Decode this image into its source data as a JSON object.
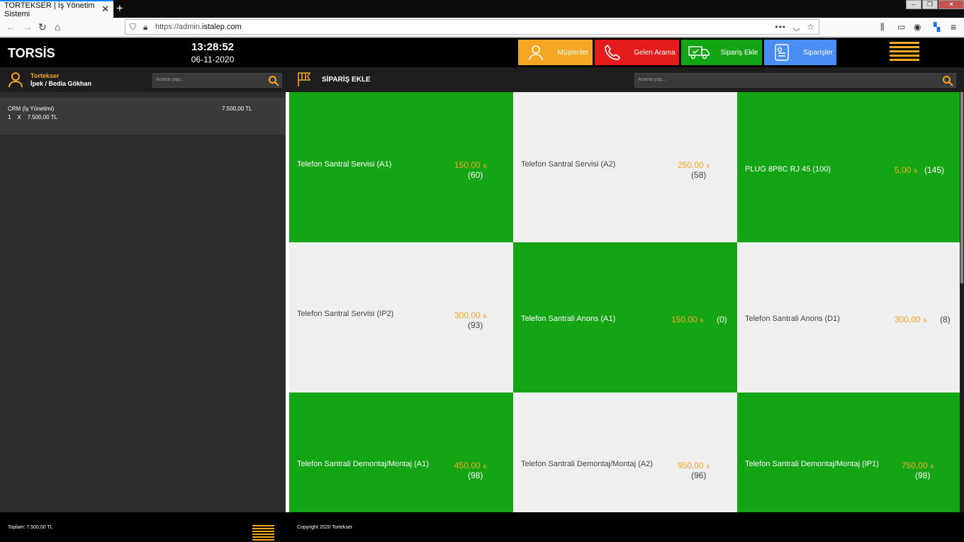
{
  "browser": {
    "tab_title": "TORTEKSER | İş Yönetim Sistemi",
    "url_prefix": "https://admin.",
    "url_domain": "istalep.com"
  },
  "header": {
    "logo": "TORSİS",
    "time": "13:28:52",
    "date": "06-11-2020",
    "buttons": [
      {
        "label": "Müşteriler",
        "color": "#f5a623",
        "icon": "user-icon"
      },
      {
        "label": "Gelen Arama",
        "color": "#e51a1a",
        "icon": "phone-icon"
      },
      {
        "label": "Sipariş Ekle",
        "color": "#14a514",
        "icon": "truck-icon"
      },
      {
        "label": "Siparişler",
        "color": "#4a8df5",
        "icon": "order-list-icon"
      }
    ]
  },
  "user": {
    "company": "Tortekser",
    "name": "İpek / Bedia Gökhan"
  },
  "search": {
    "placeholder": "Arama yap..."
  },
  "order": {
    "item_name": "CRM (İş Yönetimi)",
    "item_qty_line": "1    X    7.500,00 TL",
    "item_price": "7.500,00 TL"
  },
  "section": {
    "title": "SİPARİŞ EKLE"
  },
  "products": [
    {
      "name": "Telefon Santral Servisi (A1)",
      "price": "150,00",
      "stock": "(60)"
    },
    {
      "name": "Telefon Santral Servisi (A2)",
      "price": "250,00",
      "stock": "(58)"
    },
    {
      "name": "PLUG 8P8C RJ 45 (100)",
      "price": "5,00",
      "stock": "(145)"
    },
    {
      "name": "Telefon Santral Servisi (IP2)",
      "price": "300,00",
      "stock": "(93)"
    },
    {
      "name": "Telefon Santrali Anons (A1)",
      "price": "150,00",
      "stock": "(0)"
    },
    {
      "name": "Telefon Santrali Anons (D1)",
      "price": "300,00",
      "stock": "(8)"
    },
    {
      "name": "Telefon Santrali Demontaj/Montaj (A1)",
      "price": "450,00",
      "stock": "(98)"
    },
    {
      "name": "Telefon Santrali Demontaj/Montaj (A2)",
      "price": "950,00",
      "stock": "(96)"
    },
    {
      "name": "Telefon Santrali Demontaj/Montaj (IP1)",
      "price": "750,00",
      "stock": "(98)"
    }
  ],
  "currency_symbol": "₺",
  "footer": {
    "total": "Toplam: 7.500,00 TL",
    "copyright": "Copyright 2020 Tortekser"
  }
}
